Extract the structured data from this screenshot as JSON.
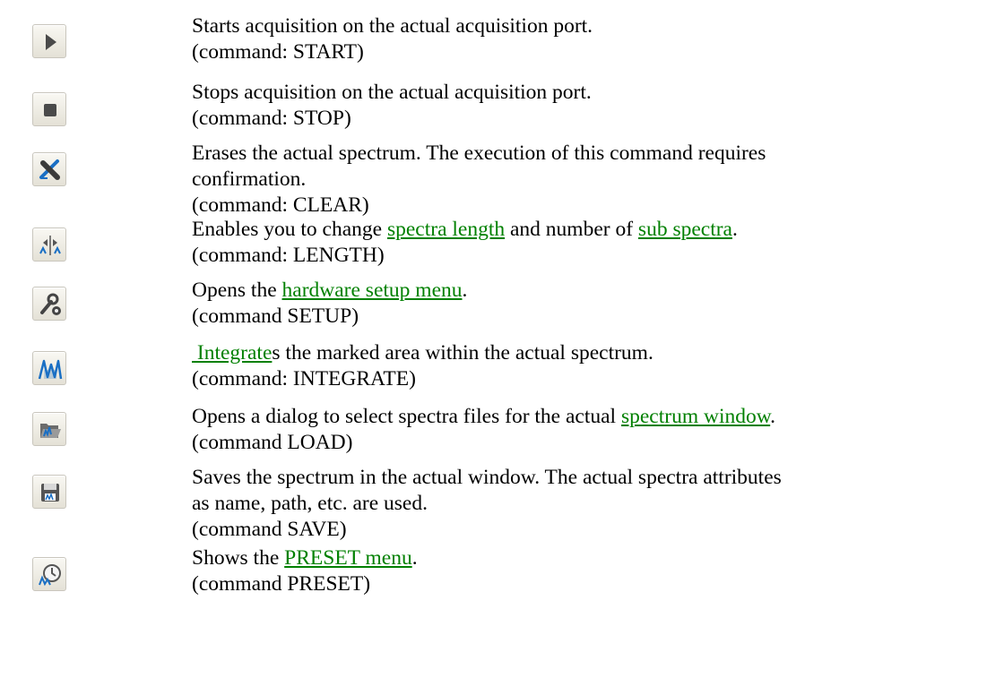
{
  "commands": [
    {
      "icon": "start-icon",
      "desc_parts": [
        "Starts acquisition on the actual acquisition port."
      ],
      "command": "(command: START)"
    },
    {
      "icon": "stop-icon",
      "desc_parts": [
        "Stops acquisition on the actual acquisition port."
      ],
      "command": "(command: STOP)"
    },
    {
      "icon": "clear-icon",
      "desc_line1": "Erases the actual spectrum. The execution of this command requires",
      "desc_line2": "confirmation.",
      "command": "(command: CLEAR)"
    },
    {
      "icon": "length-icon",
      "text1": "Enables you to change ",
      "link1": "spectra length",
      "text2": " and number of ",
      "link2": "sub spectra",
      "text3": ".",
      "command": "(command: LENGTH)"
    },
    {
      "icon": "setup-icon",
      "text1": "Opens the ",
      "link1": "hardware setup menu",
      "text2": ".",
      "command": "(command SETUP)"
    },
    {
      "icon": "integrate-icon",
      "link1": " Integrate",
      "text1": "s the marked area within the actual spectrum.",
      "command": "(command: INTEGRATE)"
    },
    {
      "icon": "load-icon",
      "text1": "Opens a dialog to select spectra files for the actual ",
      "link1": "spectrum window",
      "text2": ".",
      "command": "(command LOAD)"
    },
    {
      "icon": "save-icon",
      "desc_line1": "Saves the spectrum in the actual window. The actual spectra attributes",
      "desc_line2": "as name, path, etc. are used.",
      "command": "(command SAVE)"
    },
    {
      "icon": "preset-icon",
      "text1": "Shows the ",
      "link1": "PRESET menu",
      "text2": ".",
      "command": "(command PRESET)"
    }
  ]
}
